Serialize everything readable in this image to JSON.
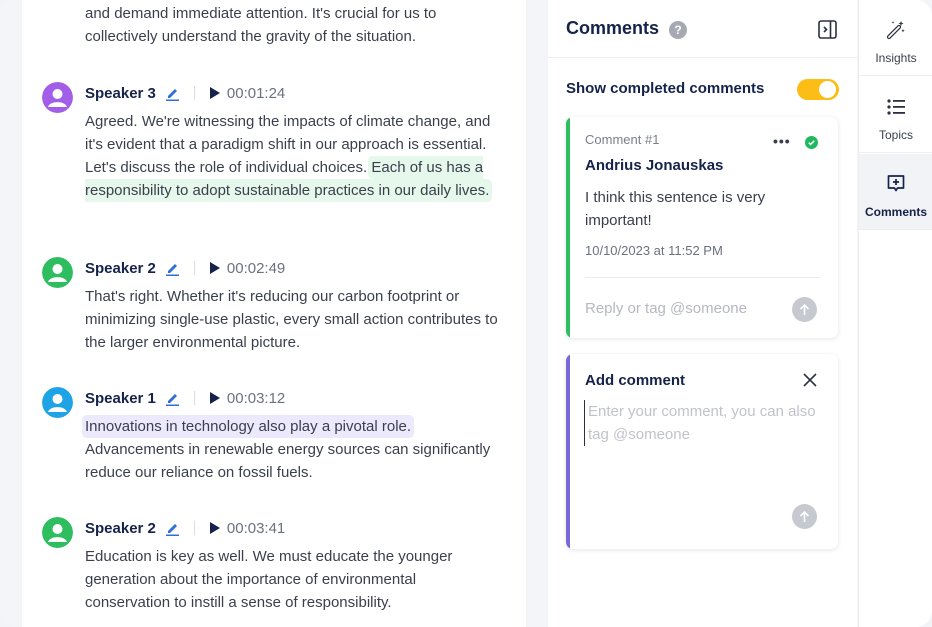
{
  "transcript": {
    "intro_text": "and demand immediate attention. It's crucial for us to collectively understand the gravity of the situation.",
    "segments": [
      {
        "speaker": "Speaker 3",
        "avatar_color": "#a25ee8",
        "timestamp": "00:01:24",
        "text_plain": "Agreed. We're witnessing the impacts of climate change, and it's evident that a paradigm shift in our approach is essential. Let's discuss the role of individual choices.",
        "text_highlight": "Each of us has a responsibility to adopt sustainable practices in our daily lives.",
        "highlight_color": "#e6f8ec"
      },
      {
        "speaker": "Speaker 2",
        "avatar_color": "#2ebd5f",
        "timestamp": "00:02:49",
        "text_plain": "That's right. Whether it's reducing our carbon footprint or minimizing single-use plastic, every small action contributes to the larger environmental picture."
      },
      {
        "speaker": "Speaker 1",
        "avatar_color": "#1ea4e6",
        "timestamp": "00:03:12",
        "text_highlight": "Innovations in technology also play a pivotal role.",
        "text_plain": "Advancements in renewable energy sources can significantly reduce our reliance on fossil fuels.",
        "highlight_color": "#ebe9fb"
      },
      {
        "speaker": "Speaker 2",
        "avatar_color": "#2ebd5f",
        "timestamp": "00:03:41",
        "text_plain": "Education is key as well. We must educate the younger generation about the importance of environmental conservation to instill a sense of responsibility."
      }
    ]
  },
  "comments_panel": {
    "title": "Comments",
    "help_icon": "?",
    "toggle_label": "Show completed comments",
    "toggle_on": true,
    "toggle_color": "#fbbd16",
    "comment": {
      "number_label": "Comment #1",
      "author": "Andrius Jonauskas",
      "body": "I think this sentence is very important!",
      "date": "10/10/2023 at 11:52 PM",
      "reply_placeholder": "Reply or tag @someone",
      "accent_color": "#2ebd5f",
      "status": "completed"
    },
    "add_comment": {
      "title": "Add comment",
      "placeholder": "Enter your comment, you can also tag @someone",
      "accent_color": "#7b68d9"
    }
  },
  "right_nav": {
    "items": [
      {
        "label": "Insights",
        "icon": "magic-wand-icon",
        "active": false
      },
      {
        "label": "Topics",
        "icon": "list-icon",
        "active": false
      },
      {
        "label": "Comments",
        "icon": "comment-add-icon",
        "active": true
      }
    ]
  }
}
